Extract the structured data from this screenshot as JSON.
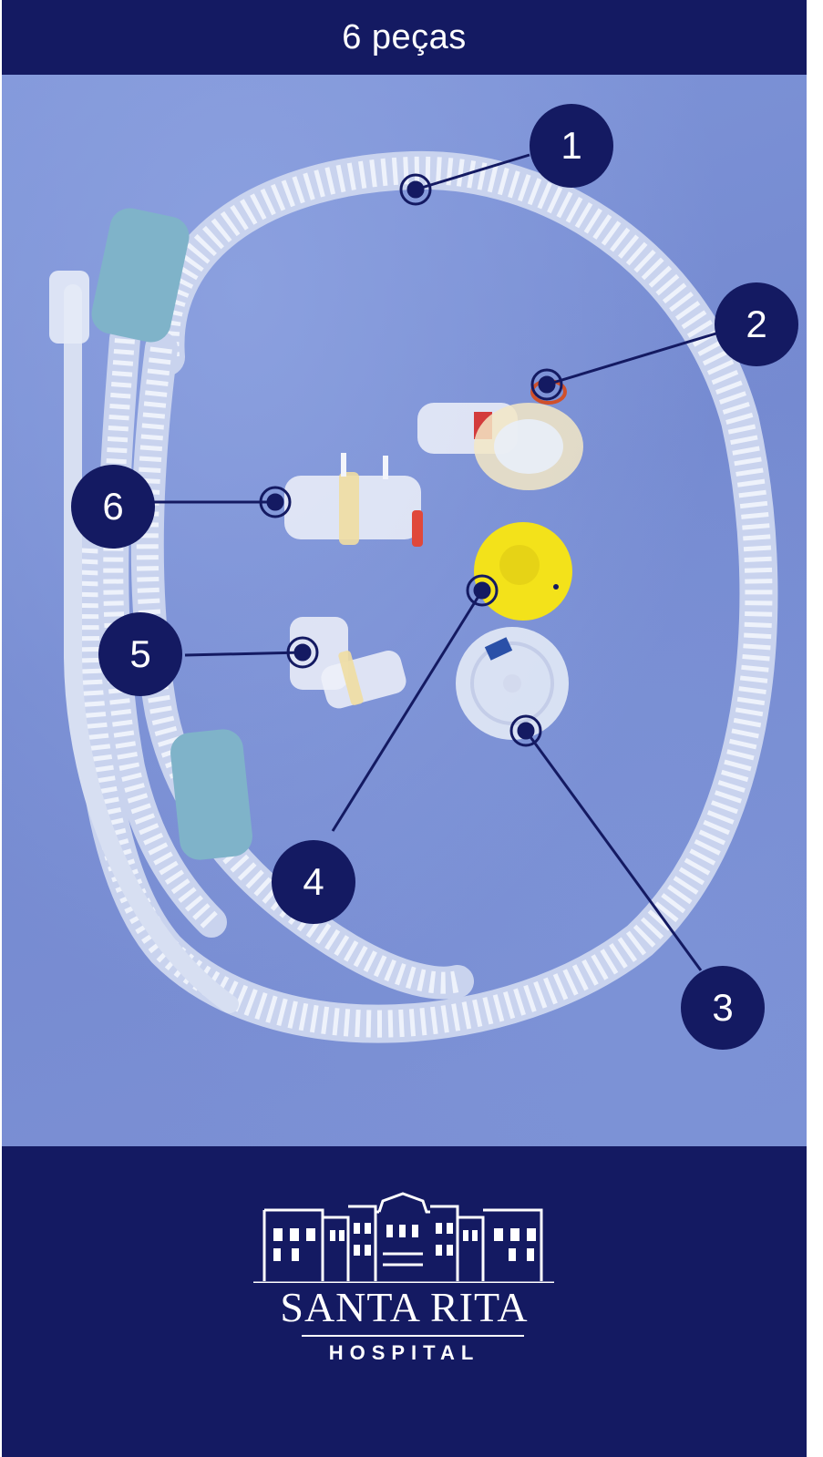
{
  "header": {
    "title": "6 peças"
  },
  "photo": {
    "callouts": [
      {
        "label": "1"
      },
      {
        "label": "2"
      },
      {
        "label": "3"
      },
      {
        "label": "4"
      },
      {
        "label": "5"
      },
      {
        "label": "6"
      }
    ]
  },
  "footer": {
    "logo_name": "SANTA RITA",
    "logo_sub": "HOSPITAL"
  },
  "colors": {
    "brand_navy": "#141a62",
    "cloth_blue": "#7d91d5",
    "tube_clear": "#e9eef8",
    "connector_teal": "#7fb3c9",
    "cap_yellow": "#f3e21a"
  }
}
